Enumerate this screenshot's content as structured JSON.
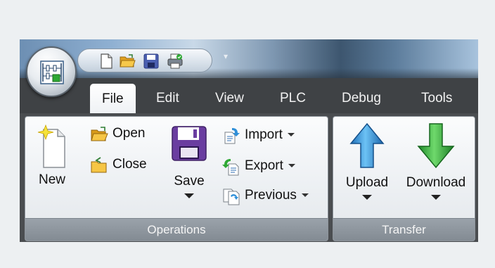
{
  "tabs": [
    {
      "label": "File",
      "active": true
    },
    {
      "label": "Edit",
      "active": false
    },
    {
      "label": "View",
      "active": false
    },
    {
      "label": "PLC",
      "active": false
    },
    {
      "label": "Debug",
      "active": false
    },
    {
      "label": "Tools",
      "active": false
    }
  ],
  "quick_access": {
    "icons": [
      "new-document-icon",
      "open-folder-icon",
      "save-disk-icon",
      "print-icon"
    ],
    "dropdown_glyph": "▾"
  },
  "operations": {
    "label": "Operations",
    "new_label": "New",
    "open_label": "Open",
    "close_label": "Close",
    "save_label": "Save",
    "import_label": "Import",
    "export_label": "Export",
    "previous_label": "Previous"
  },
  "transfer": {
    "label": "Transfer",
    "upload_label": "Upload",
    "download_label": "Download"
  },
  "colors": {
    "upload_arrow": "#2f8fd8",
    "download_arrow": "#2ea834",
    "save_disk": "#6a3da0",
    "folder": "#f0b429"
  }
}
